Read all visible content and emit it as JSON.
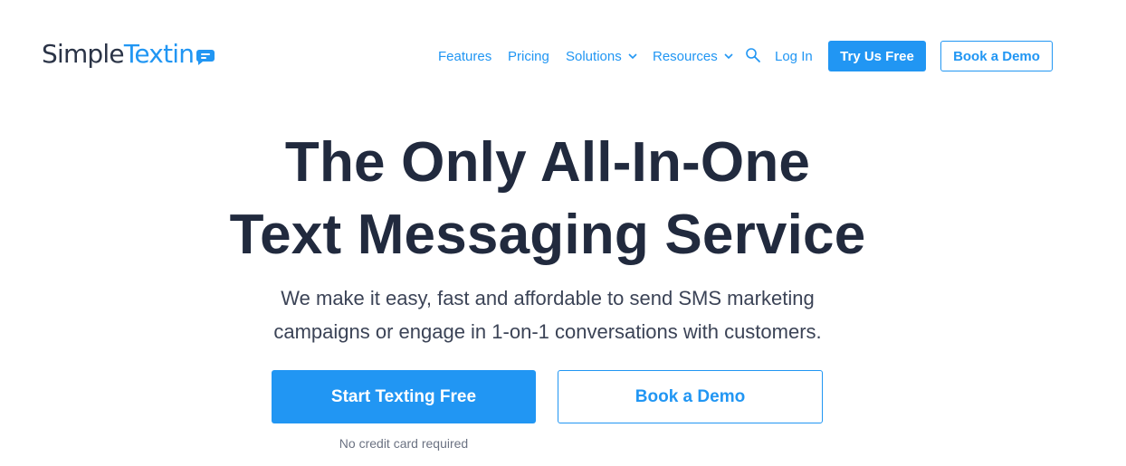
{
  "brand": {
    "logo_part1": "Simple",
    "logo_part2": "Textin",
    "logo_icon": "chat-bubble-icon",
    "primary_color": "#2196f3",
    "text_color": "#212a3e"
  },
  "nav": {
    "features": "Features",
    "pricing": "Pricing",
    "solutions": "Solutions",
    "resources": "Resources",
    "search_icon": "search-icon",
    "login": "Log In",
    "try_free": "Try Us Free",
    "book_demo": "Book a Demo"
  },
  "hero": {
    "title_line1": "The Only All-In-One",
    "title_line2": "Text Messaging Service",
    "subtitle_line1": "We make it easy, fast and affordable to send SMS marketing",
    "subtitle_line2": "campaigns or engage in 1-on-1 conversations with customers.",
    "cta_primary": "Start Texting Free",
    "cta_secondary": "Book a Demo",
    "cta_note": "No credit card required"
  }
}
